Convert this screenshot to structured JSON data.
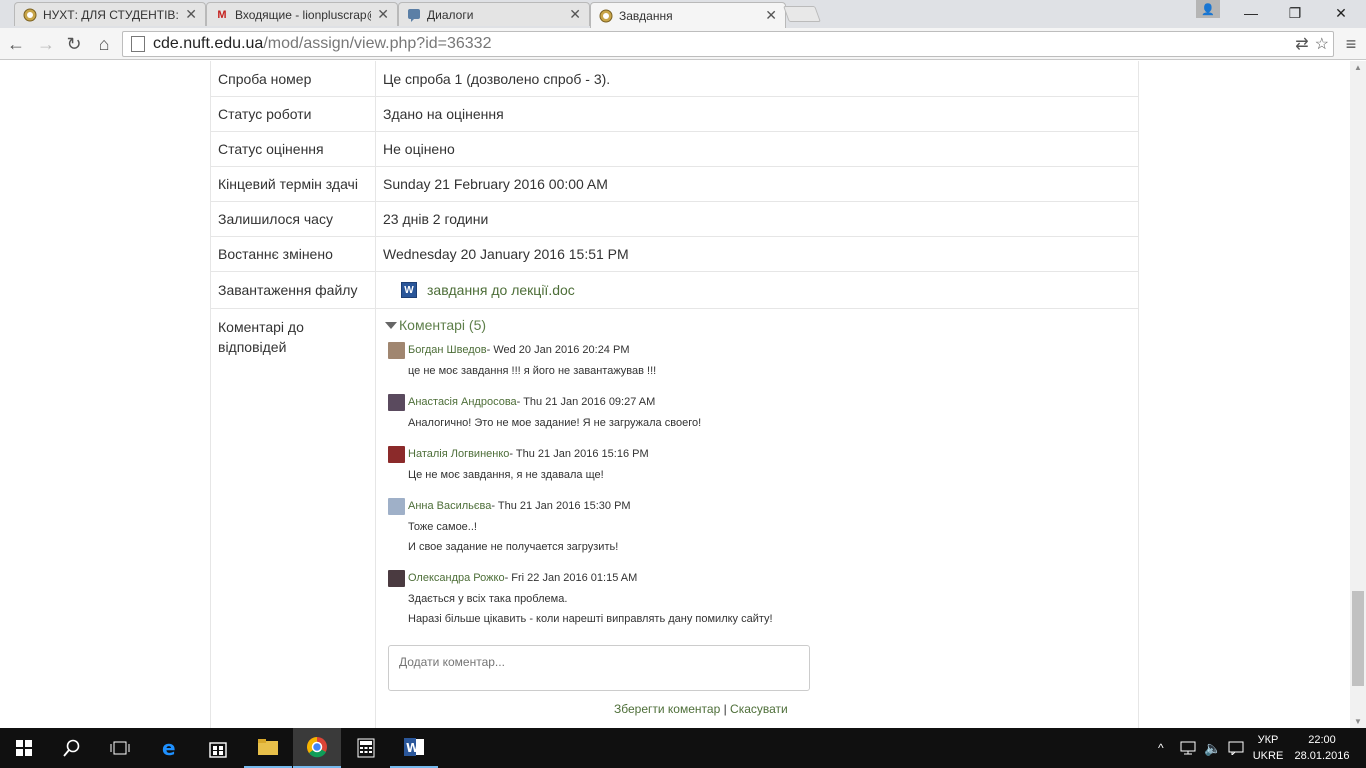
{
  "browser": {
    "tabs": [
      {
        "title": "НУХТ: ДЛЯ СТУДЕНТІВ: До",
        "icon": "moodle-icon"
      },
      {
        "title": "Входящие - lionpluscrap@",
        "icon": "gmail-icon"
      },
      {
        "title": "Диалоги",
        "icon": "vk-icon"
      },
      {
        "title": "Завдання",
        "icon": "moodle-icon"
      }
    ],
    "url_host": "cde.nuft.edu.ua",
    "url_path": "/mod/assign/view.php?id=36332"
  },
  "submission": {
    "rows": [
      {
        "label": "Спроба номер",
        "value": "Це спроба 1 (дозволено спроб - 3)."
      },
      {
        "label": "Статус роботи",
        "value": "Здано на оцінення"
      },
      {
        "label": "Статус оцінення",
        "value": "Не оцінено"
      },
      {
        "label": "Кінцевий термін здачі",
        "value": "Sunday 21 February 2016 00:00 AM"
      },
      {
        "label": "Залишилося часу",
        "value": "23 днів 2 години"
      },
      {
        "label": "Востаннє змінено",
        "value": "Wednesday 20 January 2016 15:51 PM"
      }
    ],
    "file_label": "Завантаження файлу",
    "file_name": "завдання до лекції.doc",
    "comments_label": "Коментарі до відповідей"
  },
  "comments": {
    "toggle": "Коментарі (5)",
    "items": [
      {
        "author": "Богдан Шведов",
        "time": " - Wed 20 Jan 2016 20:24 PM",
        "lines": [
          "це не моє завдання !!! я його не завантажував !!!"
        ],
        "avatar_color": "#a08670"
      },
      {
        "author": "Анастасія Андросова",
        "time": " - Thu 21 Jan 2016 09:27 AM",
        "lines": [
          "Аналогично! Это не мое задание! Я не загружала своего!"
        ],
        "avatar_color": "#5a4a5e"
      },
      {
        "author": "Наталія Логвиненко",
        "time": " - Thu 21 Jan 2016 15:16 PM",
        "lines": [
          "Це не моє завдання, я не здавала ще!"
        ],
        "avatar_color": "#8b2a2a"
      },
      {
        "author": "Анна Васильєва",
        "time": " - Thu 21 Jan 2016 15:30 PM",
        "lines": [
          "Тоже самое..!",
          "И свое задание не получается загрузить!"
        ],
        "avatar_color": "#9fb0c8"
      },
      {
        "author": "Олександра Рожко",
        "time": " - Fri 22 Jan 2016 01:15 AM",
        "lines": [
          "Здається у всіх така проблема.",
          "Наразі більше цікавить - коли нарешті виправлять дану помилку сайту!"
        ],
        "avatar_color": "#4a3a40"
      }
    ],
    "placeholder": "Додати коментар...",
    "save_label": "Зберегти коментар",
    "separator": " | ",
    "cancel_label": "Скасувати"
  },
  "taskbar": {
    "lang_top": "УКР",
    "lang_bottom": "UKRE",
    "time": "22:00",
    "date": "28.01.2016"
  }
}
